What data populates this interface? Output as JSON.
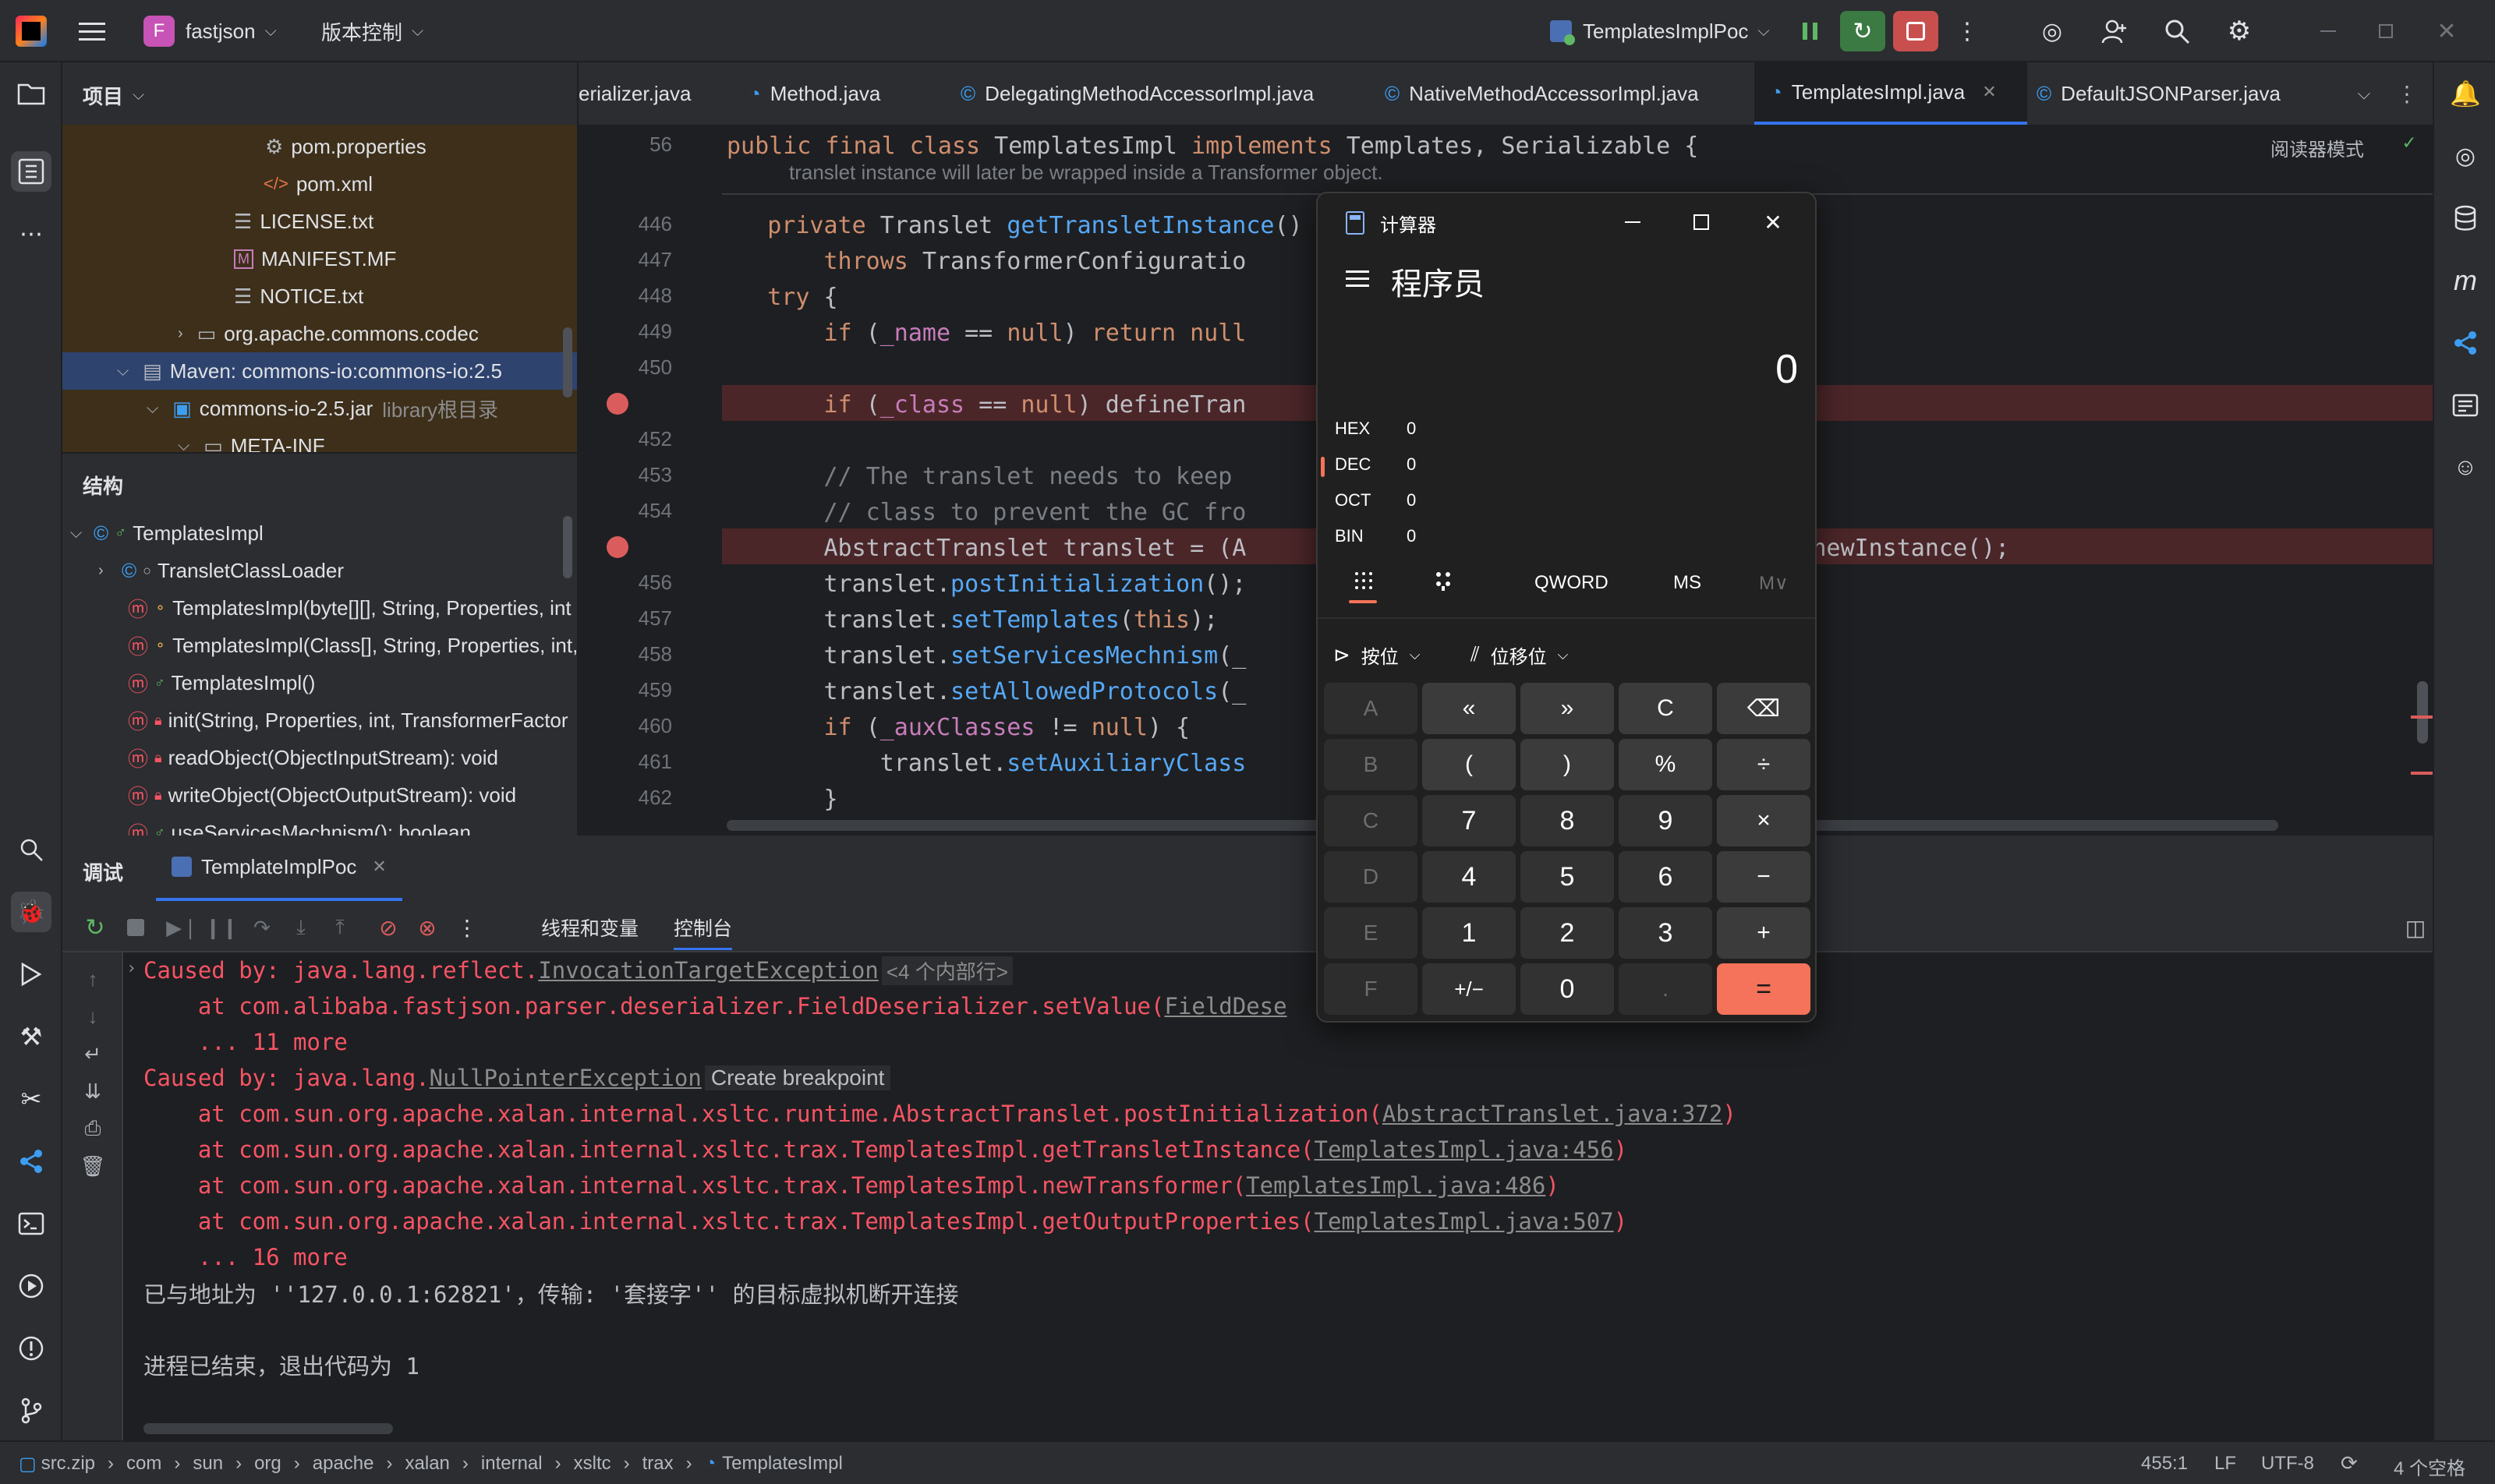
{
  "titlebar": {
    "app_icon": "intellij-logo",
    "project_badge": "F",
    "project_name": "fastjson",
    "vcs_label": "版本控制",
    "run_config": "TemplatesImplPoc"
  },
  "project_panel": {
    "title": "项目",
    "tree": [
      {
        "label": "pom.properties",
        "icon": "gear-file"
      },
      {
        "label": "pom.xml",
        "icon": "xml-file"
      },
      {
        "label": "LICENSE.txt",
        "icon": "text-file"
      },
      {
        "label": "MANIFEST.MF",
        "icon": "manifest-file"
      },
      {
        "label": "NOTICE.txt",
        "icon": "text-file"
      },
      {
        "label": "org.apache.commons.codec",
        "icon": "folder"
      },
      {
        "label": "Maven: commons-io:commons-io:2.5",
        "icon": "library"
      },
      {
        "label": "commons-io-2.5.jar",
        "suffix": "library根目录",
        "icon": "jar"
      },
      {
        "label": "META-INF",
        "icon": "folder"
      }
    ]
  },
  "structure_panel": {
    "title": "结构",
    "items": [
      {
        "label": "TemplatesImpl"
      },
      {
        "label": "TransletClassLoader"
      },
      {
        "label": "TemplatesImpl(byte[][], String, Properties, int"
      },
      {
        "label": "TemplatesImpl(Class[], String, Properties, int,"
      },
      {
        "label": "TemplatesImpl()"
      },
      {
        "label": "init(String, Properties, int, TransformerFactor"
      },
      {
        "label": "readObject(ObjectInputStream): void"
      },
      {
        "label": "writeObject(ObjectOutputStream): void"
      },
      {
        "label": "useServicesMechnism(): boolean"
      }
    ]
  },
  "editor": {
    "tabs": [
      {
        "label": "erializer.java"
      },
      {
        "label": "Method.java"
      },
      {
        "label": "DelegatingMethodAccessorImpl.java"
      },
      {
        "label": "NativeMethodAccessorImpl.java"
      },
      {
        "label": "TemplatesImpl.java",
        "active": true
      },
      {
        "label": "DefaultJSONParser.java"
      }
    ],
    "reader_mode": "阅读器模式",
    "sticky_line_no": "56",
    "sticky_line": "public final class TemplatesImpl implements Templates, Serializable {",
    "sticky_hint": "translet instance will later be wrapped inside a Transformer object.",
    "line_numbers": [
      "446",
      "447",
      "448",
      "449",
      "450",
      "",
      "452",
      "453",
      "454",
      "",
      "456",
      "457",
      "458",
      "459",
      "460",
      "461",
      "462"
    ],
    "lines": [
      "    private Translet getTransletInstance()",
      "        throws TransformerConfiguratio",
      "    try {",
      "        if (_name == null) return null",
      "",
      "        if (_class == null) defineTran",
      "",
      "        // The translet needs to keep",
      "        // class to prevent the GC fro",
      "        AbstractTranslet translet = (A",
      "        translet.postInitialization();",
      "        translet.setTemplates(this);",
      "        translet.setServicesMechnism(_",
      "        translet.setAllowedProtocols(_",
      "        if (_auxClasses != null) {",
      "            translet.setAuxiliaryClass",
      "        }"
    ],
    "line_455_tail": "lex].newInstance();"
  },
  "debug": {
    "title": "调试",
    "session_tab": "TemplateImplPoc",
    "subtabs": [
      "线程和变量",
      "控制台"
    ],
    "console": [
      {
        "type": "err",
        "text": "Caused by: java.lang.reflect.",
        "link": "InvocationTargetException",
        "extra": "<4 个内部行>"
      },
      {
        "type": "err",
        "text": "    at com.alibaba.fastjson.parser.deserializer.FieldDeserializer.setValue(",
        "link": "FieldDese"
      },
      {
        "type": "err",
        "text": "    ... 11 more"
      },
      {
        "type": "err",
        "text": "Caused by: java.lang.",
        "link": "NullPointerException",
        "extra": "Create breakpoint"
      },
      {
        "type": "err",
        "text": "    at com.sun.org.apache.xalan.internal.xsltc.runtime.AbstractTranslet.postInitialization(",
        "link": "AbstractTranslet.java:372",
        "close": ")"
      },
      {
        "type": "err",
        "text": "    at com.sun.org.apache.xalan.internal.xsltc.trax.TemplatesImpl.getTransletInstance(",
        "link": "TemplatesImpl.java:456",
        "close": ")"
      },
      {
        "type": "err",
        "text": "    at com.sun.org.apache.xalan.internal.xsltc.trax.TemplatesImpl.newTransformer(",
        "link": "TemplatesImpl.java:486",
        "close": ")"
      },
      {
        "type": "err",
        "text": "    at com.sun.org.apache.xalan.internal.xsltc.trax.TemplatesImpl.getOutputProperties(",
        "link": "TemplatesImpl.java:507",
        "close": ")"
      },
      {
        "type": "err",
        "text": "    ... 16 more"
      },
      {
        "type": "plain",
        "text": "已与地址为 ''127.0.0.1:62821'，传输: '套接字'' 的目标虚拟机断开连接"
      },
      {
        "type": "plain",
        "text": ""
      },
      {
        "type": "plain",
        "text": "进程已结束，退出代码为 1"
      }
    ]
  },
  "statusbar": {
    "breadcrumbs": [
      "src.zip",
      "com",
      "sun",
      "org",
      "apache",
      "xalan",
      "internal",
      "xsltc",
      "trax",
      "TemplatesImpl"
    ],
    "position": "455:1",
    "line_ending": "LF",
    "encoding": "UTF-8",
    "indent": "4 个空格"
  },
  "calculator": {
    "window_title": "计算器",
    "mode": "程序员",
    "display": "0",
    "radix": [
      {
        "name": "HEX",
        "value": "0"
      },
      {
        "name": "DEC",
        "value": "0",
        "active": true
      },
      {
        "name": "OCT",
        "value": "0"
      },
      {
        "name": "BIN",
        "value": "0"
      }
    ],
    "word_size": "QWORD",
    "ms_label": "MS",
    "mem_label": "M∨",
    "bitwise_label": "按位",
    "bitshift_label": "位移位",
    "keys": [
      [
        "A",
        "«",
        "»",
        "C",
        "⌫"
      ],
      [
        "B",
        "(",
        ")",
        "%",
        "÷"
      ],
      [
        "C",
        "7",
        "8",
        "9",
        "×"
      ],
      [
        "D",
        "4",
        "5",
        "6",
        "−"
      ],
      [
        "E",
        "1",
        "2",
        "3",
        "+"
      ],
      [
        "F",
        "+/−",
        "0",
        ".",
        "="
      ]
    ],
    "accent": "#f4735a"
  }
}
